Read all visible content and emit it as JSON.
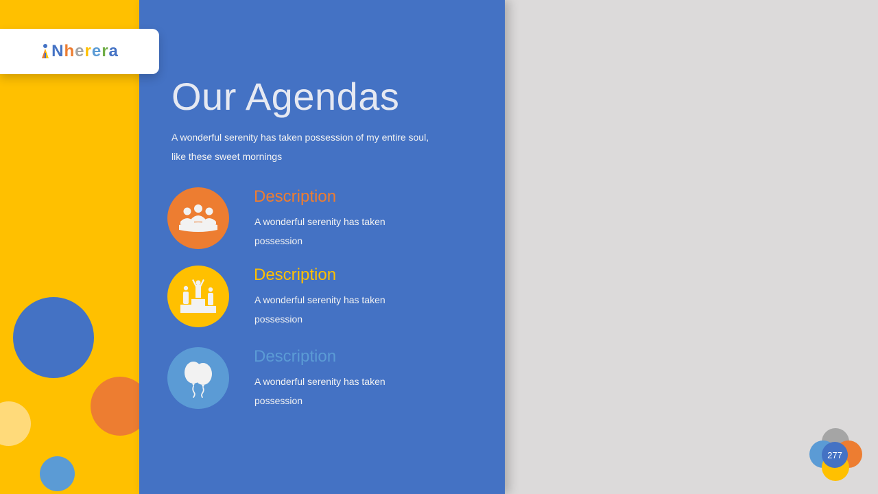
{
  "brand": {
    "logo_text": "Nherera",
    "logo_letters": [
      {
        "char": "N",
        "color": "#4472C4"
      },
      {
        "char": "h",
        "color": "#ED7D31"
      },
      {
        "char": "e",
        "color": "#A5A5A5"
      },
      {
        "char": "r",
        "color": "#FFC000"
      },
      {
        "char": "e",
        "color": "#5B9BD5"
      },
      {
        "char": "r",
        "color": "#70AD47"
      },
      {
        "char": "a",
        "color": "#4472C4"
      }
    ]
  },
  "slide": {
    "title": "Our Agendas",
    "subtitle": "A wonderful  serenity has taken possession of my entire soul, like these sweet mornings",
    "page_number": "277"
  },
  "agenda": [
    {
      "title": "Description",
      "description": "A wonderful  serenity has taken possession",
      "icon": "meeting-group-icon",
      "color": "#ED7D31"
    },
    {
      "title": "Description",
      "description": "A wonderful  serenity has taken possession",
      "icon": "podium-winners-icon",
      "color": "#FFC000"
    },
    {
      "title": "Description",
      "description": "A wonderful  serenity has taken possession",
      "icon": "balloons-icon",
      "color": "#5B9BD5"
    }
  ],
  "colors": {
    "yellow": "#FFC000",
    "blue": "#4472C4",
    "orange": "#ED7D31",
    "sky": "#5B9BD5",
    "gray_bg": "#DCDADA"
  }
}
